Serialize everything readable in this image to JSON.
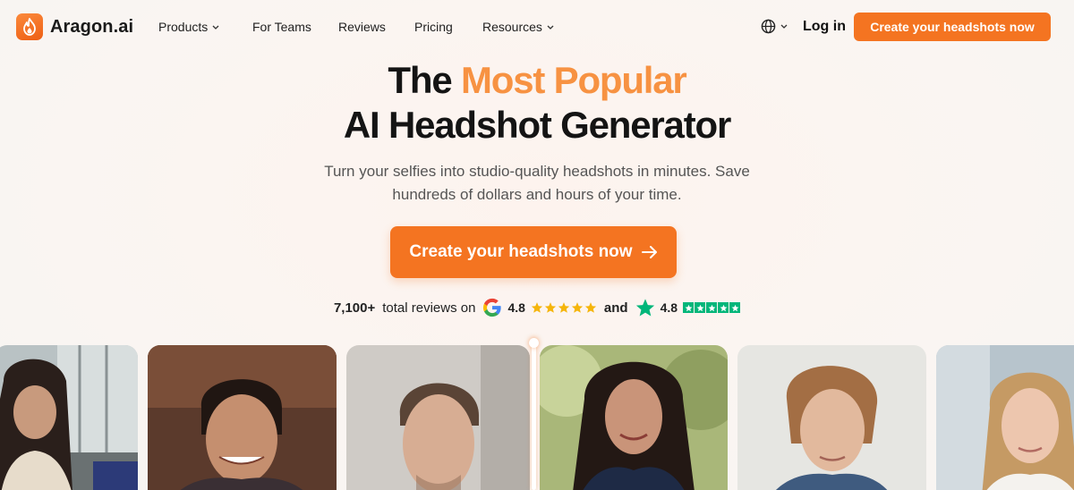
{
  "brand": {
    "name": "Aragon.ai",
    "accent_color": "#f47421",
    "highlight_color": "#f79242"
  },
  "nav": {
    "items": [
      {
        "label": "Products",
        "has_dropdown": true
      },
      {
        "label": "For Teams",
        "has_dropdown": false
      },
      {
        "label": "Reviews",
        "has_dropdown": false
      },
      {
        "label": "Pricing",
        "has_dropdown": false
      },
      {
        "label": "Resources",
        "has_dropdown": true
      }
    ],
    "language_icon": "globe-icon",
    "login_label": "Log in",
    "cta_label": "Create your headshots now"
  },
  "hero": {
    "title_prefix": "The ",
    "title_highlight": "Most Popular",
    "title_line2": "AI Headshot Generator",
    "subtitle_line1": "Turn your selfies into studio-quality headshots in minutes. Save",
    "subtitle_line2": "hundreds of dollars and hours of your time.",
    "cta_label": "Create your headshots now",
    "cta_icon": "arrow-right-icon"
  },
  "reviews": {
    "count": "7,100+",
    "label": "total reviews on",
    "google_rating": "4.8",
    "google_stars": 5,
    "conjunction": "and",
    "trustpilot_rating": "4.8",
    "trustpilot_stars": 5,
    "star_color": "#f5b50a",
    "trustpilot_color": "#00b67a"
  },
  "gallery": {
    "photos": [
      {
        "subject": "woman with long dark hair in beige sweater, outdoors",
        "type": "selfie"
      },
      {
        "subject": "smiling young man with curly hair",
        "type": "selfie"
      },
      {
        "subject": "young man with short hair, indoor",
        "type": "selfie"
      },
      {
        "subject": "woman with long dark hair in navy blazer, outdoors",
        "type": "ai-headshot"
      },
      {
        "subject": "young man with wavy hair in denim jacket",
        "type": "ai-headshot"
      },
      {
        "subject": "blonde woman in white blouse",
        "type": "ai-headshot"
      }
    ]
  }
}
